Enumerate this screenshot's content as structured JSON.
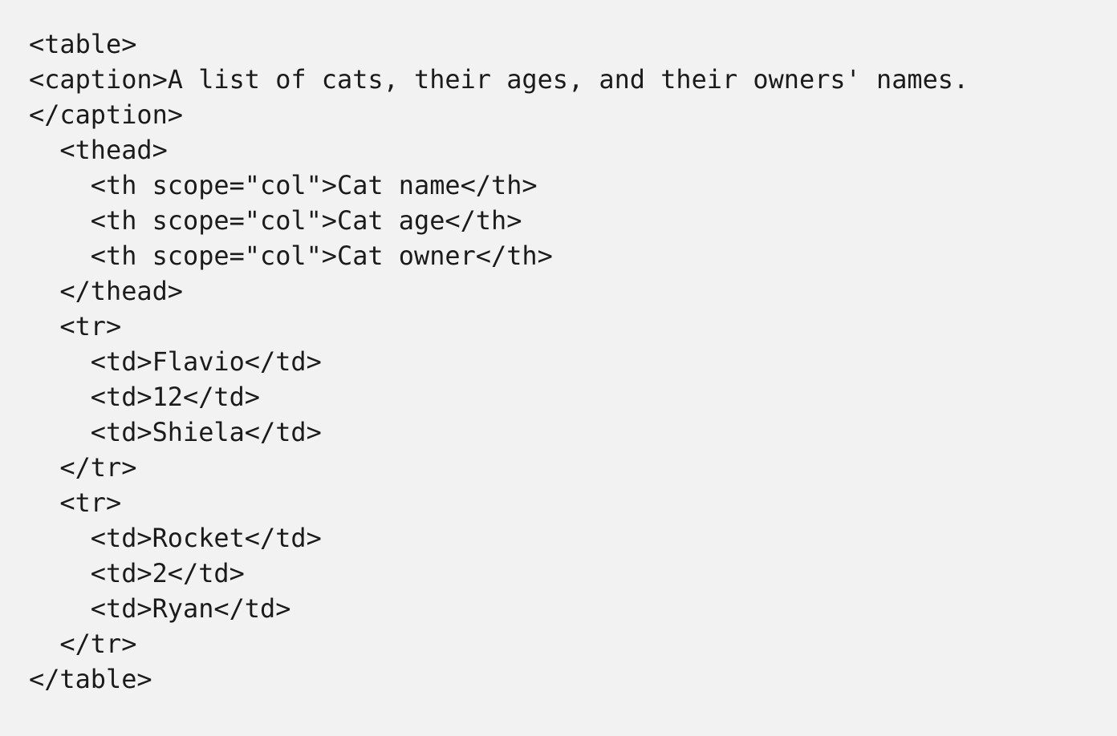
{
  "code_lines": [
    "<table>",
    "<caption>A list of cats, their ages, and their owners' names.",
    "</caption>",
    "  <thead>",
    "    <th scope=\"col\">Cat name</th>",
    "    <th scope=\"col\">Cat age</th>",
    "    <th scope=\"col\">Cat owner</th>",
    "  </thead>",
    "  <tr>",
    "    <td>Flavio</td>",
    "    <td>12</td>",
    "    <td>Shiela</td>",
    "  </tr>",
    "  <tr>",
    "    <td>Rocket</td>",
    "    <td>2</td>",
    "    <td>Ryan</td>",
    "  </tr>",
    "</table>"
  ]
}
